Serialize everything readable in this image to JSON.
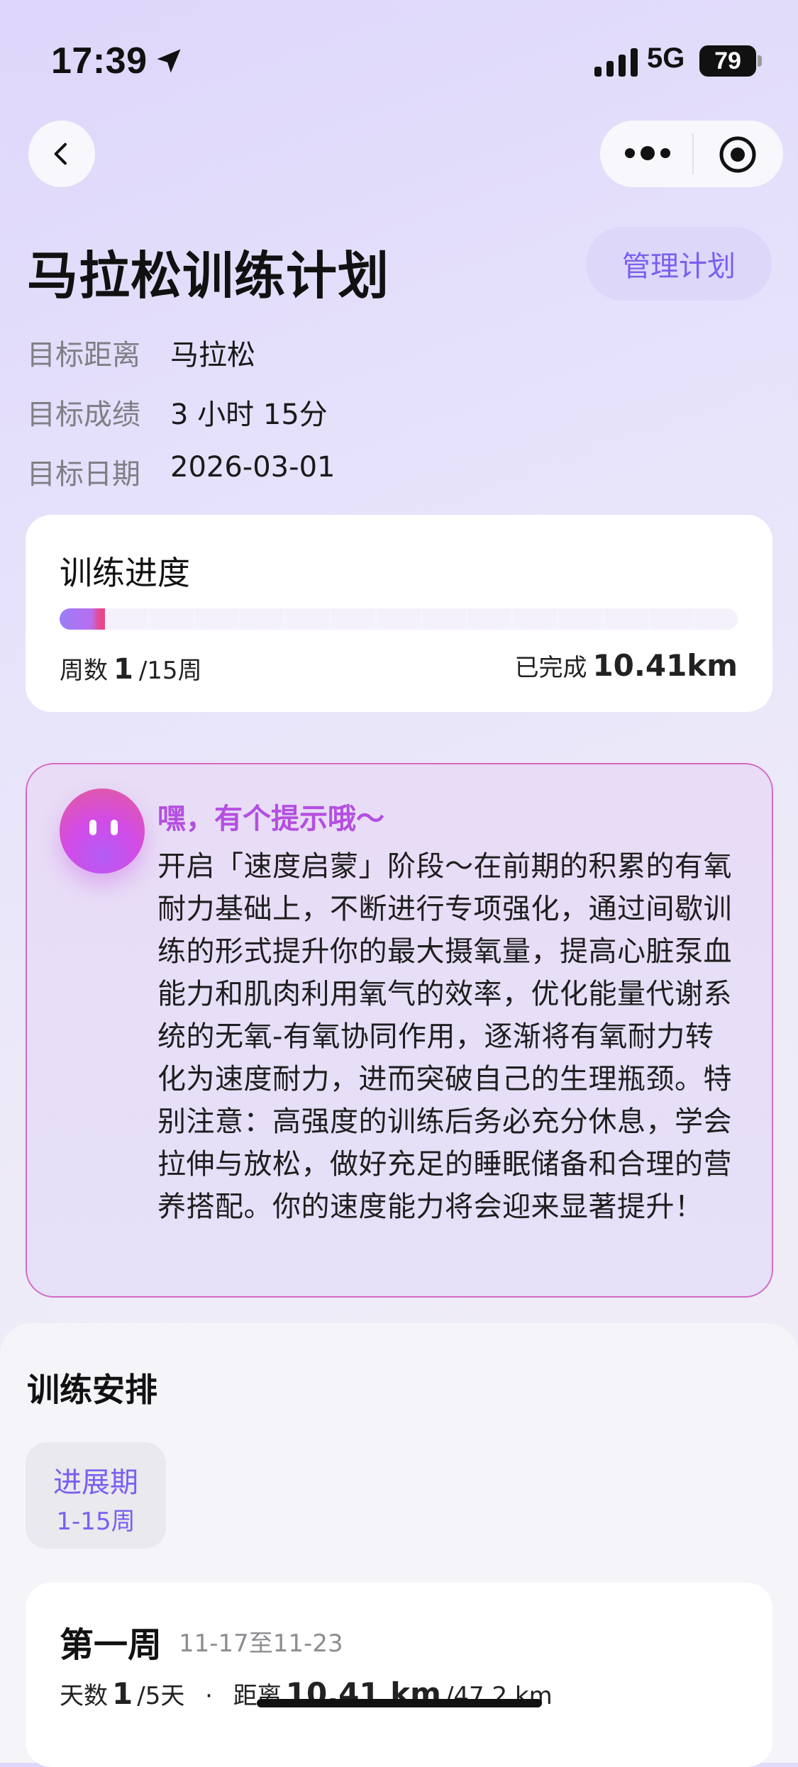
{
  "status_bar": {
    "time": "17:39",
    "network": "5G",
    "battery": "79"
  },
  "header": {
    "title": "马拉松训练计划",
    "manage_label": "管理计划"
  },
  "goals": [
    {
      "label": "目标距离",
      "value": "马拉松"
    },
    {
      "label": "目标成绩",
      "value": "3 小时 15分"
    },
    {
      "label": "目标日期",
      "value": "2026-03-01"
    }
  ],
  "progress": {
    "title": "训练进度",
    "weeks_prefix": "周数",
    "current_week": "1",
    "total_weeks_text": "/15周",
    "fraction": 0.067,
    "completed_label": "已完成",
    "completed_value": "10.41km"
  },
  "tip": {
    "title": "嘿，有个提示哦～",
    "body": "开启「速度启蒙」阶段～在前期的积累的有氧耐力基础上，不断进行专项强化，通过间歇训练的形式提升你的最大摄氧量，提高心脏泵血能力和肌肉利用氧气的效率，优化能量代谢系统的无氧-有氧协同作用，逐渐将有氧耐力转化为速度耐力，进而突破自己的生理瓶颈。特别注意：高强度的训练后务必充分休息，学会拉伸与放松，做好充足的睡眠储备和合理的营养搭配。你的速度能力将会迎来显著提升！"
  },
  "schedule": {
    "title": "训练安排",
    "phase_name": "进展期",
    "phase_range": "1-15周",
    "week": {
      "title": "第一周",
      "dates": "11-17至11-23",
      "days_prefix": "天数",
      "days_done": "1",
      "days_total": "/5天",
      "separator": "·",
      "distance_prefix": "距离",
      "distance_done": "10.41 km",
      "distance_total": "/47.2 km"
    }
  },
  "colors": {
    "accent": "#7b5ff0",
    "tip_title": "#b44fe0",
    "tip_border": "#d46bc3"
  }
}
